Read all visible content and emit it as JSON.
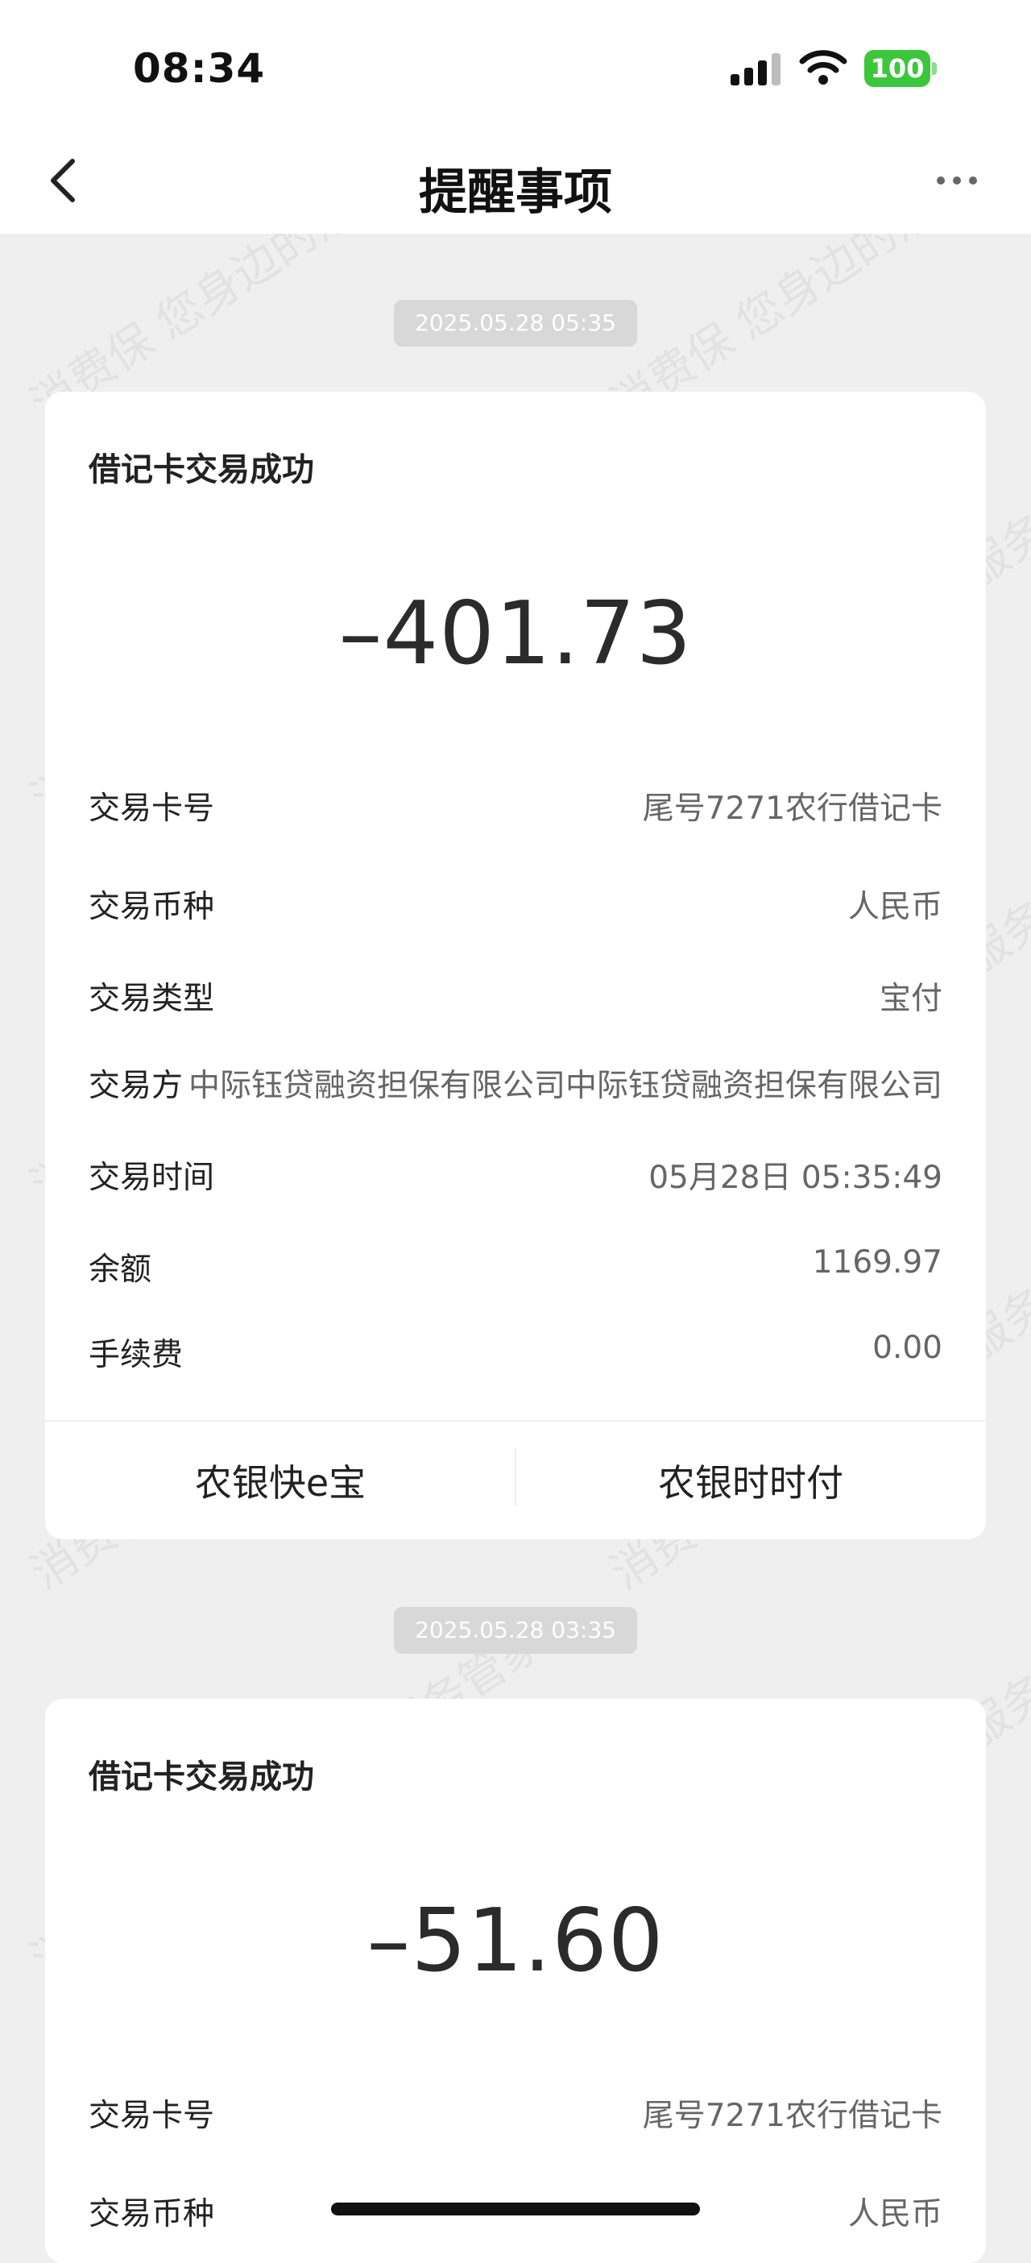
{
  "status": {
    "time": "08:34",
    "battery": "100"
  },
  "nav": {
    "title": "提醒事项"
  },
  "watermark": "消费保 您身边的消费服务管家",
  "messages": [
    {
      "timestamp": "2025.05.28 05:35",
      "title": "借记卡交易成功",
      "amount": "–401.73",
      "rows": [
        {
          "label": "交易卡号",
          "value": "尾号7271农行借记卡"
        },
        {
          "label": "交易币种",
          "value": "人民币"
        },
        {
          "label": "交易类型",
          "value": "宝付"
        },
        {
          "label": "交易方",
          "value": "中际钰贷融资担保有限公司中际钰贷融资担保有限公司"
        },
        {
          "label": "交易时间",
          "value": "05月28日 05:35:49"
        },
        {
          "label": "余额",
          "value": "1169.97"
        },
        {
          "label": "手续费",
          "value": "0.00"
        }
      ],
      "actions": [
        "农银快e宝",
        "农银时时付"
      ]
    },
    {
      "timestamp": "2025.05.28 03:35",
      "title": "借记卡交易成功",
      "amount": "–51.60",
      "rows": [
        {
          "label": "交易卡号",
          "value": "尾号7271农行借记卡"
        },
        {
          "label": "交易币种",
          "value": "人民币"
        }
      ]
    }
  ],
  "colors": {
    "battery": "#3cc63c",
    "background": "#efefef",
    "stamp": "#d8d8d8"
  }
}
